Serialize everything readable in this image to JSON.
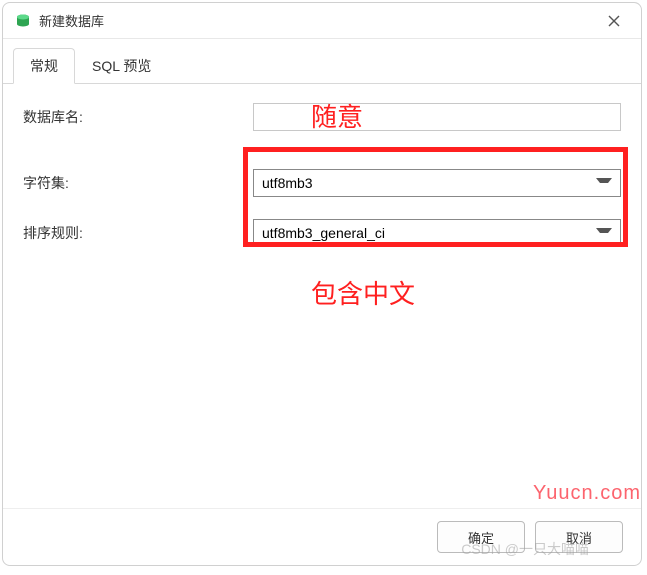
{
  "window": {
    "title": "新建数据库"
  },
  "tabs": {
    "general": "常规",
    "sqlPreview": "SQL 预览"
  },
  "form": {
    "dbNameLabel": "数据库名:",
    "dbNameValue": "",
    "charsetLabel": "字符集:",
    "charsetValue": "utf8mb3",
    "collationLabel": "排序规则:",
    "collationValue": "utf8mb3_general_ci"
  },
  "annotations": {
    "anyName": "随意",
    "containsChinese": "包含中文"
  },
  "footer": {
    "ok": "确定",
    "cancel": "取消"
  },
  "watermarks": {
    "yuucn": "Yuucn.com",
    "csdn": "CSDN @一只大喵喵"
  }
}
